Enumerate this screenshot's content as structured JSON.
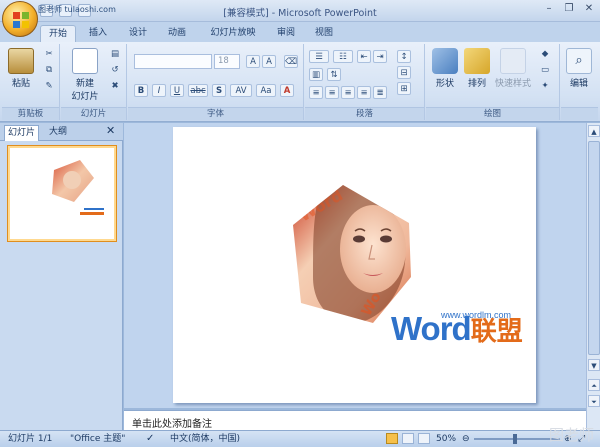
{
  "window": {
    "title": "[兼容模式] - Microsoft PowerPoint",
    "qat_text": "图老师",
    "qat_url": "tulaoshi.com"
  },
  "tabs": [
    "开始",
    "插入",
    "设计",
    "动画",
    "幻灯片放映",
    "审阅",
    "视图"
  ],
  "active_tab": 0,
  "ribbon": {
    "groups": {
      "clipboard": "剪贴板",
      "slides": "幻灯片",
      "font": "字体",
      "paragraph": "段落",
      "drawing": "绘图",
      "editing": ""
    },
    "paste_label": "粘贴",
    "new_slide_label1": "新建",
    "new_slide_label2": "幻灯片",
    "font_size_value": "18",
    "font_name_value": "",
    "bold": "B",
    "italic": "I",
    "underline": "U",
    "strike": "abc",
    "shadow": "S",
    "spacing": "AV",
    "case": "Aa",
    "shape_label": "形状",
    "arrange_label": "排列",
    "quick_style_label": "快速样式",
    "edit_label": "编辑"
  },
  "left_panel": {
    "tab_slides": "幻灯片",
    "tab_outline": "大纲",
    "slide_number": "1"
  },
  "slide": {
    "logo_word": "Word",
    "logo_cn": "联盟",
    "logo_url": "www.wordlm.com"
  },
  "notes": {
    "placeholder": "单击此处添加备注"
  },
  "status": {
    "slide_info": "幻灯片 1/1",
    "theme": "\"Office 主题\"",
    "language": "中文(简体，中国)",
    "zoom": "50%"
  },
  "watermark": "图老师",
  "colors": {
    "accent_blue": "#2f72c9",
    "accent_orange": "#e36b1a",
    "ribbon_bg": "#d3e1f3",
    "frame_bg": "#9db8db"
  }
}
